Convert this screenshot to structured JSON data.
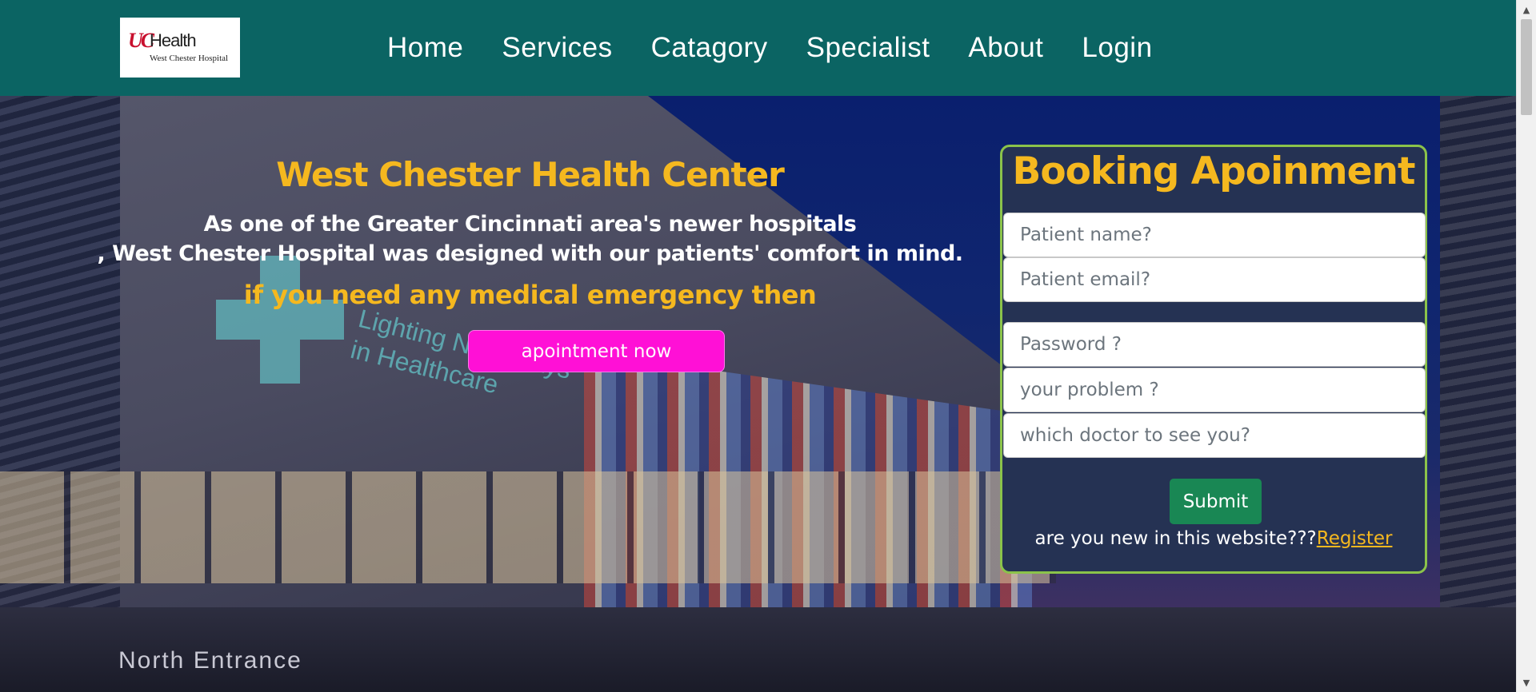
{
  "header": {
    "logo": {
      "mark": "UC",
      "name": "Health",
      "subtitle": "West Chester Hospital"
    },
    "nav": [
      {
        "label": "Home"
      },
      {
        "label": "Services"
      },
      {
        "label": "Catagory"
      },
      {
        "label": "Specialist"
      },
      {
        "label": "About"
      },
      {
        "label": "Login"
      }
    ]
  },
  "hero": {
    "title": "West Chester Health Center",
    "description_line1": "As one of the Greater Cincinnati area's newer hospitals",
    "description_line2": ", West Chester Hospital was designed with our patients' comfort in mind.",
    "emergency_text": "if you need any medical emergency then",
    "cta_label": "apointment now",
    "background_sign": "North Entrance",
    "background_projection_line1": "Lighting New Ways",
    "background_projection_line2": "in Healthcare"
  },
  "booking": {
    "title": "Booking Apoinment",
    "fields": {
      "name_placeholder": "Patient name?",
      "email_placeholder": "Patient email?",
      "password_placeholder": "Password ?",
      "problem_placeholder": "your problem ?",
      "doctor_placeholder": "which doctor to see you?"
    },
    "submit_label": "Submit",
    "register_prompt": "are you new in this website???",
    "register_link": "Register"
  },
  "colors": {
    "header_bg": "#0b6463",
    "accent_yellow": "#f5b81f",
    "cta_magenta": "#ff10d6",
    "panel_bg": "#253253",
    "panel_border": "#8bc34a",
    "submit_green": "#198754"
  },
  "icons": {
    "scroll_up": "chevron-up-icon",
    "scroll_down": "chevron-down-icon"
  }
}
